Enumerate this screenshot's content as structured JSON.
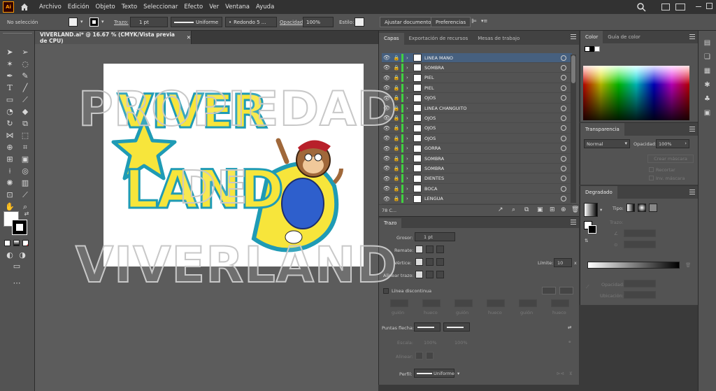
{
  "app": {
    "logo": "Ai",
    "menus": [
      "Archivo",
      "Edición",
      "Objeto",
      "Texto",
      "Seleccionar",
      "Efecto",
      "Ver",
      "Ventana",
      "Ayuda"
    ]
  },
  "control_bar": {
    "selection_status": "No selección",
    "stroke_label": "Trazo:",
    "stroke_weight": "1 pt",
    "stroke_profile": "Uniforme",
    "brush": "Redondo 5 ...",
    "opacity_label": "Opacidad:",
    "opacity_value": "100%",
    "style_label": "Estilo:",
    "doc_setup_button": "Ajustar documento",
    "prefs_button": "Preferencias"
  },
  "document": {
    "tab_title": "VIVERLAND.ai* @ 16.67 % (CMYK/Vista previa de CPU)",
    "logo_lines": [
      "VIVER",
      "LAND"
    ]
  },
  "watermark": {
    "line1": "PROPIEDAD",
    "line2": "DE",
    "line3": "VIVERLAND"
  },
  "layers_panel": {
    "tabs": [
      "Capas",
      "Exportación de recursos",
      "Mesas de trabajo"
    ],
    "layers": [
      {
        "name": "LINEA MANO",
        "selected": true,
        "color": "#40d040"
      },
      {
        "name": "SOMBRA",
        "selected": false,
        "color": "#40d040"
      },
      {
        "name": "PIEL",
        "selected": false,
        "color": "#40d040"
      },
      {
        "name": "PIEL",
        "selected": false,
        "color": "#40d040"
      },
      {
        "name": "OJOS",
        "selected": false,
        "color": "#40d040"
      },
      {
        "name": "LINEA CHANGUITO",
        "selected": false,
        "color": "#40d040"
      },
      {
        "name": "OJOS",
        "selected": false,
        "color": "#40d040"
      },
      {
        "name": "OJOS",
        "selected": false,
        "color": "#40d040"
      },
      {
        "name": "OJOS",
        "selected": false,
        "color": "#40d040"
      },
      {
        "name": "GORRA",
        "selected": false,
        "color": "#40d040"
      },
      {
        "name": "SOMBRA",
        "selected": false,
        "color": "#40d040"
      },
      {
        "name": "SOMBRA",
        "selected": false,
        "color": "#40d040"
      },
      {
        "name": "DIENTES",
        "selected": false,
        "color": "#40d040"
      },
      {
        "name": "BOCA",
        "selected": false,
        "color": "#40d040"
      },
      {
        "name": "LENGUA",
        "selected": false,
        "color": "#40d040"
      }
    ],
    "layer_count": "78 C..."
  },
  "stroke_panel": {
    "title": "Trazo",
    "weight_label": "Grosor:",
    "weight_value": "1 pt",
    "cap_label": "Remate:",
    "corner_label": "Vértice:",
    "limit_label": "Límite:",
    "limit_value": "10",
    "limit_unit": "x",
    "align_label": "Alinear trazo:",
    "dashed_label": "Línea discontinua",
    "dash_labels": [
      "guión",
      "hueco",
      "guión",
      "hueco",
      "guión",
      "hueco"
    ],
    "arrows_label": "Puntas flecha:",
    "scale_label": "Escala:",
    "scale_values": [
      "100%",
      "100%"
    ],
    "align_arrow_label": "Alinear:",
    "profile_label": "Perfil:",
    "profile_value": "Uniforme"
  },
  "color_panel": {
    "tabs": [
      "Color",
      "Guía de color"
    ]
  },
  "transparency_panel": {
    "title": "Transparencia",
    "blend_mode": "Normal",
    "opacity_label": "Opacidad:",
    "opacity_value": "100%",
    "make_mask_button": "Crear máscara",
    "clip_label": "Recortar",
    "invert_label": "Inv. máscara"
  },
  "gradient_panel": {
    "title": "Degradado",
    "type_label": "Tipo:",
    "stroke_label": "Trazo:",
    "opacity_label": "Opacidad:",
    "location_label": "Ubicación:"
  },
  "colors": {
    "logo_yellow": "#f7e53b",
    "logo_teal": "#1f9bb5",
    "logo_navy": "#1b2d6e",
    "selection_blue": "#46607f",
    "layer_green": "#40d040"
  }
}
